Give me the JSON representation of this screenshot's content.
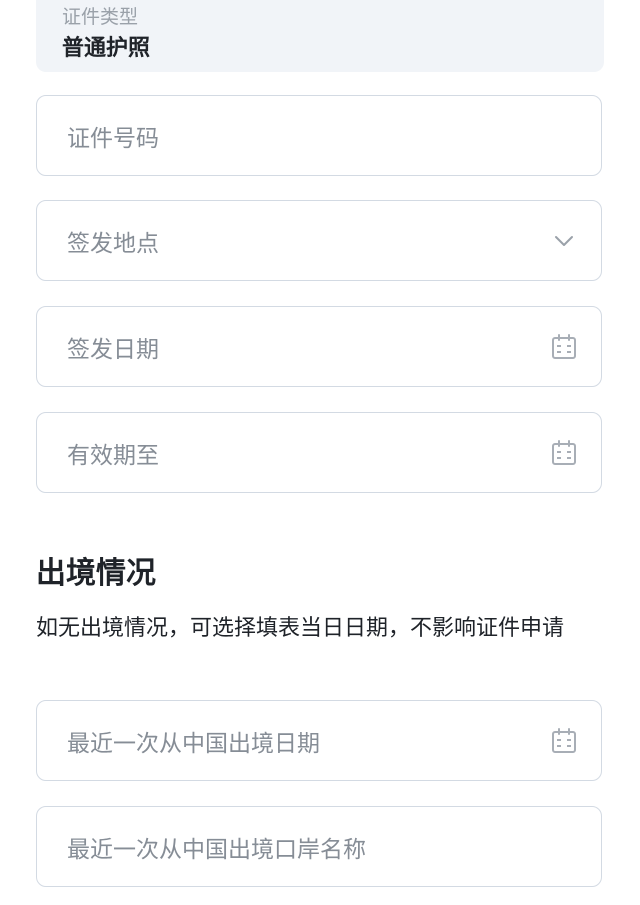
{
  "id_type": {
    "label": "证件类型",
    "value": "普通护照"
  },
  "fields": {
    "id_number": {
      "placeholder": "证件号码"
    },
    "issue_place": {
      "placeholder": "签发地点",
      "icon": "chevron-down-icon"
    },
    "issue_date": {
      "placeholder": "签发日期",
      "icon": "calendar-icon"
    },
    "valid_until": {
      "placeholder": "有效期至",
      "icon": "calendar-icon"
    }
  },
  "exit_section": {
    "title": "出境情况",
    "description": "如无出境情况，可选择填表当日日期，不影响证件申请",
    "last_exit_date": {
      "placeholder": "最近一次从中国出境日期",
      "icon": "calendar-icon"
    },
    "last_exit_port": {
      "placeholder": "最近一次从中国出境口岸名称"
    }
  },
  "colors": {
    "border": "#d3dae3",
    "readonly_bg": "#f1f4f8",
    "placeholder": "#868d96",
    "text": "#1f2329"
  }
}
